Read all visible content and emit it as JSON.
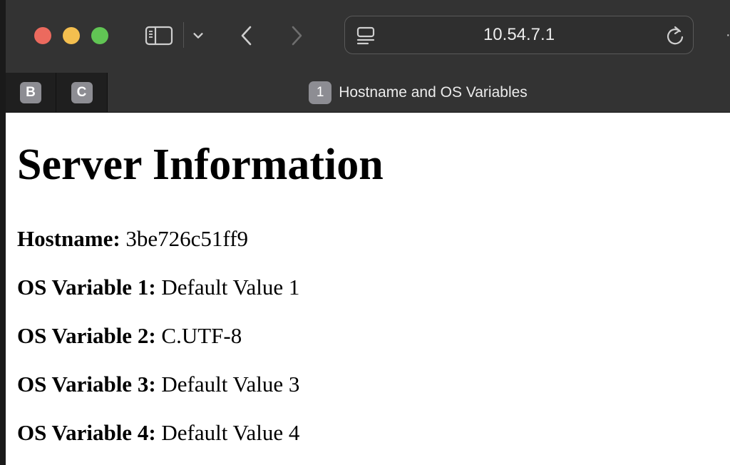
{
  "browser": {
    "address": "10.54.7.1",
    "toolbar_icons": [
      "sidebar-icon",
      "chevron-down-icon",
      "back-icon",
      "forward-icon",
      "page-menu-icon",
      "reload-icon"
    ],
    "tabs": [
      {
        "badge": "B",
        "active": false
      },
      {
        "badge": "C",
        "active": false
      },
      {
        "badge": "1",
        "title": "Hostname and OS Variables",
        "active": true
      }
    ],
    "colors": {
      "close": "#ec6a5e",
      "minimize": "#f4bf4f",
      "zoom": "#61c554"
    }
  },
  "page": {
    "heading": "Server Information",
    "rows": [
      {
        "label": "Hostname:",
        "value": "3be726c51ff9"
      },
      {
        "label": "OS Variable 1:",
        "value": "Default Value 1"
      },
      {
        "label": "OS Variable 2:",
        "value": "C.UTF-8"
      },
      {
        "label": "OS Variable 3:",
        "value": "Default Value 3"
      },
      {
        "label": "OS Variable 4:",
        "value": "Default Value 4"
      }
    ]
  }
}
